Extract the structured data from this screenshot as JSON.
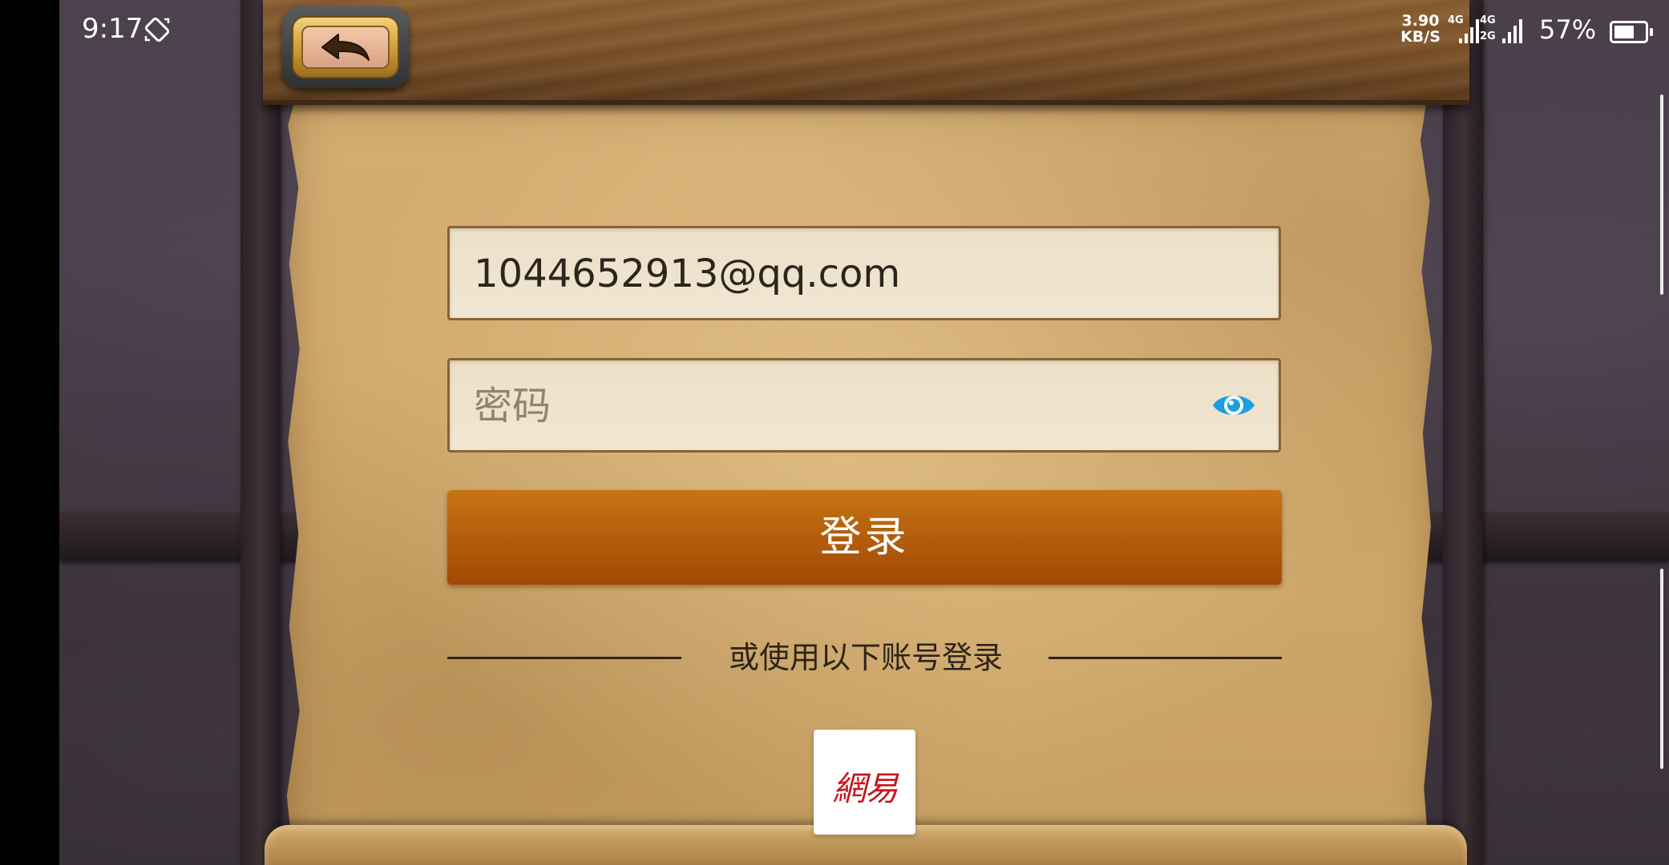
{
  "status_bar": {
    "time": "9:17",
    "net_speed_value": "3.90",
    "net_speed_unit": "KB/S",
    "sim1_label": "4G",
    "sim2_label_top": "4G",
    "sim2_label_bottom": "2G",
    "battery_percent": "57%",
    "battery_level": 0.57
  },
  "header": {
    "back_icon": "back-arrow-icon"
  },
  "login_form": {
    "account_value": "1044652913@qq.com",
    "password_placeholder": "密码",
    "password_value": "",
    "eye_icon": "eye-icon",
    "login_label": "登录"
  },
  "alt_login": {
    "label": "或使用以下账号登录",
    "providers": [
      {
        "name": "netease",
        "label": "網易"
      }
    ]
  },
  "colors": {
    "login_button": "#b25c0b",
    "eye_icon": "#1a9fe0",
    "netease_brand": "#c7161d",
    "parchment": "#cfa86c",
    "wall": "#3a3039"
  }
}
